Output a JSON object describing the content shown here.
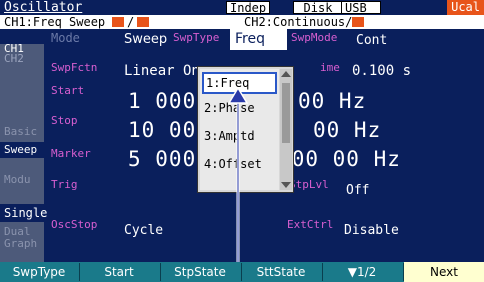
{
  "top": {
    "title": "Oscillator",
    "mode_indep": "Indep",
    "disk": "Disk",
    "usb": "USB",
    "ucal": "Ucal"
  },
  "channel_bar": {
    "ch1": "CH1:Freq Sweep",
    "ch1_slash": "/",
    "ch2": "CH2:Continuous/"
  },
  "side_tabs": {
    "ch1": "CH1",
    "ch2": "CH2",
    "basic": "Basic",
    "sweep": "Sweep",
    "modu": "Modu",
    "single": "Single",
    "dual_graph_1": "Dual",
    "dual_graph_2": "Graph"
  },
  "params": {
    "mode_label": "Mode",
    "mode_value": "Sweep",
    "swptype_label": "SwpType",
    "swptype_value": "Freq",
    "swpmode_label": "SwpMode",
    "swpmode_value": "Cont",
    "swpfctn_label": "SwpFctn",
    "swpfctn_value": "Linear On",
    "time_label": "ime",
    "time_value": "0.100 s",
    "start_label": "Start",
    "start_value_left": "1 000. 0",
    "start_value_right": "00 Hz",
    "stop_label": "Stop",
    "stop_value_left": "10 000.",
    "stop_value_right": "00 Hz",
    "marker_label": "Marker",
    "marker_value": "5 000. 000 000 00 Hz",
    "trig_label": "Trig",
    "stplvl_label": "StpLvl",
    "stplvl_value": "Off",
    "oscstop_label": "OscStop",
    "oscstop_value": "Cycle",
    "extctrl_label": "ExtCtrl",
    "extctrl_value": "Disable"
  },
  "dropdown": {
    "options": [
      "1:Freq",
      "2:Phase",
      "3:Amptd",
      "4:Offset"
    ],
    "selected": "1:Freq"
  },
  "softkeys": [
    "SwpType",
    "Start",
    "StpState",
    "SttState",
    "▼1/2",
    "Next"
  ],
  "colors": {
    "background": "#0a1f5c",
    "accent_orange": "#e8541a",
    "label_yellow": "#ffe640",
    "label_magenta": "#d85fd0",
    "softkey_teal": "#1a7a8a",
    "next_highlight": "#ffffd0"
  }
}
